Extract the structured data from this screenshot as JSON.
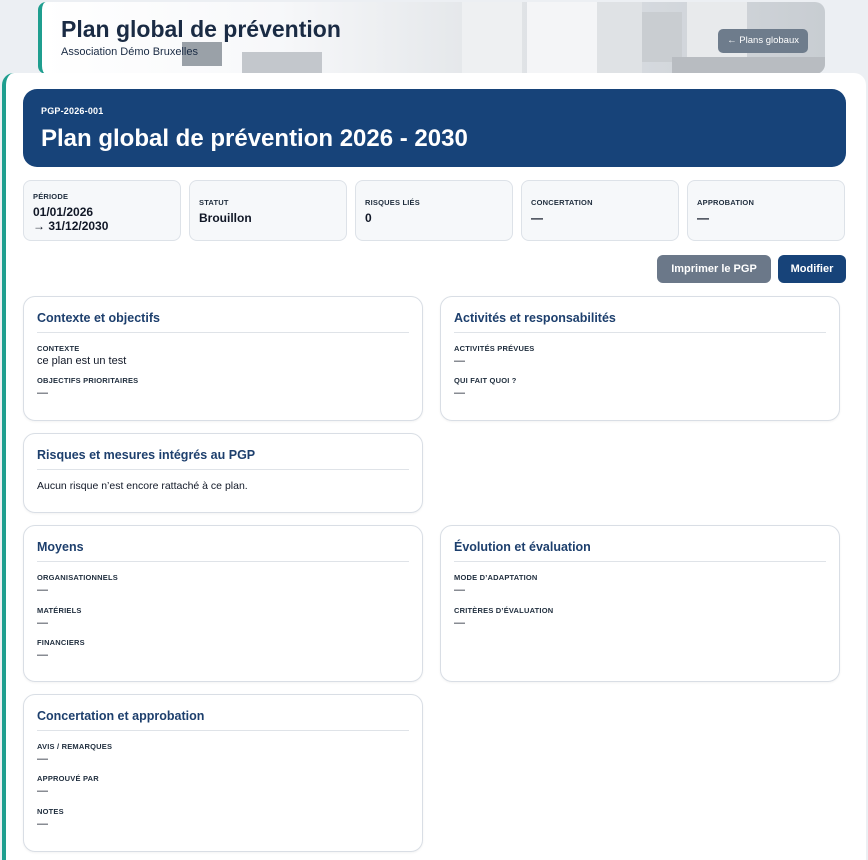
{
  "header": {
    "title": "Plan global de prévention",
    "organization": "Association Démo Bruxelles",
    "back_label": "← Plans globaux"
  },
  "plan": {
    "code": "PGP-2026-001",
    "title": "Plan global de prévention 2026 - 2030"
  },
  "stats": {
    "period": {
      "label": "Période",
      "start": "01/01/2026",
      "end": "→ 31/12/2030"
    },
    "status": {
      "label": "Statut",
      "value": "Brouillon"
    },
    "risks": {
      "label": "Risques liés",
      "value": "0"
    },
    "consultation": {
      "label": "Concertation",
      "value": "—"
    },
    "approval": {
      "label": "Approbation",
      "value": "—"
    }
  },
  "actions": {
    "print_label": "Imprimer le PGP",
    "edit_label": "Modifier"
  },
  "sections": {
    "context": {
      "title": "Contexte et objectifs",
      "context_label": "CONTEXTE",
      "context_value": "ce plan est un test",
      "objectives_label": "OBJECTIFS PRIORITAIRES",
      "objectives_value": "—"
    },
    "activities": {
      "title": "Activités et responsabilités",
      "planned_label": "ACTIVITÉS PRÉVUES",
      "planned_value": "—",
      "who_label": "QUI FAIT QUOI ?",
      "who_value": "—"
    },
    "risks": {
      "title": "Risques et mesures intégrés au PGP",
      "empty_text": "Aucun risque n’est encore rattaché à ce plan."
    },
    "means": {
      "title": "Moyens",
      "org_label": "ORGANISATIONNELS",
      "org_value": "—",
      "material_label": "MATÉRIELS",
      "material_value": "—",
      "financial_label": "FINANCIERS",
      "financial_value": "—"
    },
    "evolution": {
      "title": "Évolution et évaluation",
      "mode_label": "MODE D’ADAPTATION",
      "mode_value": "—",
      "criteria_label": "CRITÈRES D’ÉVALUATION",
      "criteria_value": "—"
    },
    "concertation": {
      "title": "Concertation et approbation",
      "opinion_label": "AVIS / REMARQUES",
      "opinion_value": "—",
      "approved_label": "APPROUVÉ PAR",
      "approved_value": "—",
      "notes_label": "NOTES",
      "notes_value": "—"
    }
  }
}
